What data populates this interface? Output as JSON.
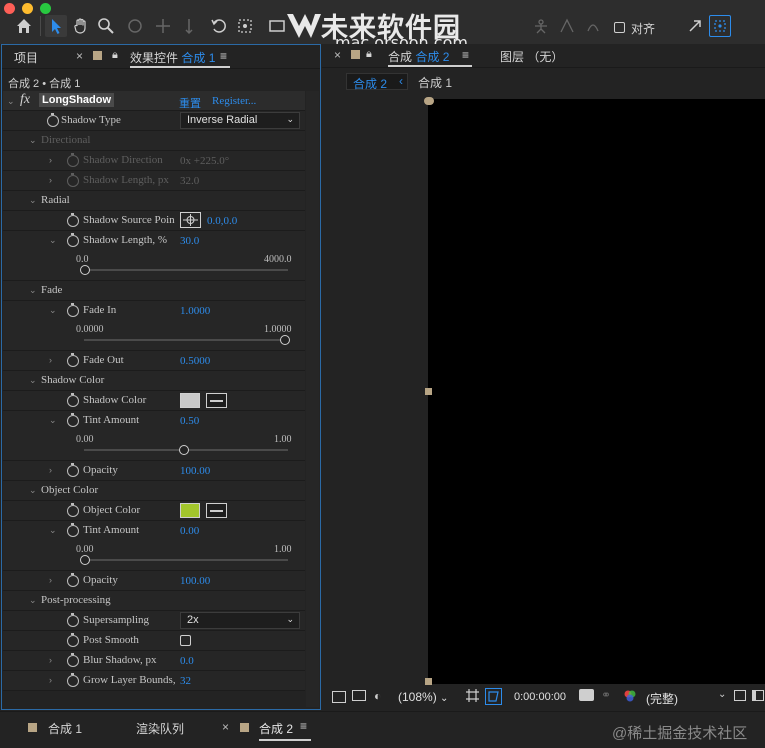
{
  "watermark": {
    "title": "未来软件园",
    "url": "mac.orsoon.com",
    "footer": "@稀土掘金技术社区"
  },
  "toolbar": {
    "align_label": "对齐",
    "icons": [
      "home-icon",
      "selection-arrow-icon",
      "hand-icon",
      "zoom-icon",
      "rotate-icon",
      "anchor-icon",
      "pan-icon",
      "undo-icon",
      "snap-icon",
      "rectangle-icon",
      "pen-icon"
    ]
  },
  "left_panel": {
    "tab_project": "项目",
    "tab_effects_prefix": "效果控件",
    "tab_effects_comp": "合成 1",
    "breadcrumb": "合成 2 • 合成 1",
    "effect": {
      "fx": "fx",
      "name": "LongShadow",
      "reset": "重置",
      "register": "Register..."
    },
    "rows": {
      "shadow_type": {
        "label": "Shadow Type",
        "value": "Inverse Radial"
      },
      "directional": "Directional",
      "shadow_direction": {
        "label": "Shadow Direction",
        "value": "0x +225.0°"
      },
      "shadow_length_px": {
        "label": "Shadow Length, px",
        "value": "32.0"
      },
      "radial": "Radial",
      "shadow_source_point": {
        "label": "Shadow Source Poin",
        "value": "0.0,0.0"
      },
      "shadow_length_pct": {
        "label": "Shadow Length, %",
        "value": "30.0",
        "min": "0.0",
        "max": "4000.0"
      },
      "fade": "Fade",
      "fade_in": {
        "label": "Fade In",
        "value": "1.0000",
        "min": "0.0000",
        "max": "1.0000"
      },
      "fade_out": {
        "label": "Fade Out",
        "value": "0.5000"
      },
      "shadow_color_group": "Shadow Color",
      "shadow_color": {
        "label": "Shadow Color",
        "color": "#c8c8c8"
      },
      "tint_amount_1": {
        "label": "Tint Amount",
        "value": "0.50",
        "min": "0.00",
        "max": "1.00"
      },
      "opacity_1": {
        "label": "Opacity",
        "value": "100.00"
      },
      "object_color_group": "Object Color",
      "object_color": {
        "label": "Object Color",
        "color": "#a2c52c"
      },
      "tint_amount_2": {
        "label": "Tint Amount",
        "value": "0.00",
        "min": "0.00",
        "max": "1.00"
      },
      "opacity_2": {
        "label": "Opacity",
        "value": "100.00"
      },
      "post_processing": "Post-processing",
      "supersampling": {
        "label": "Supersampling",
        "value": "2x"
      },
      "post_smooth": {
        "label": "Post Smooth"
      },
      "blur_shadow": {
        "label": "Blur Shadow, px",
        "value": "0.0"
      },
      "grow_layer_bounds": {
        "label": "Grow Layer Bounds,",
        "value": "32"
      }
    }
  },
  "right_panel": {
    "tab_comp_prefix": "合成",
    "tab_comp_name": "合成 2",
    "tab_layer": "图层 （无）",
    "sub_tab_active": "合成 2",
    "sub_tab_other": "合成 1",
    "viewer_bar": {
      "zoom": "(108%)",
      "timecode": "0:00:00:00",
      "resolution": "(完整)"
    }
  },
  "bottom_tabs": {
    "tab1": "合成 1",
    "tab2": "渲染队列",
    "tab3": "合成 2"
  },
  "colors": {
    "accent": "#2d8ceb",
    "shadow_color": "#c8c8c8",
    "object_color": "#a2c52c",
    "comp_bg": "#000000"
  }
}
